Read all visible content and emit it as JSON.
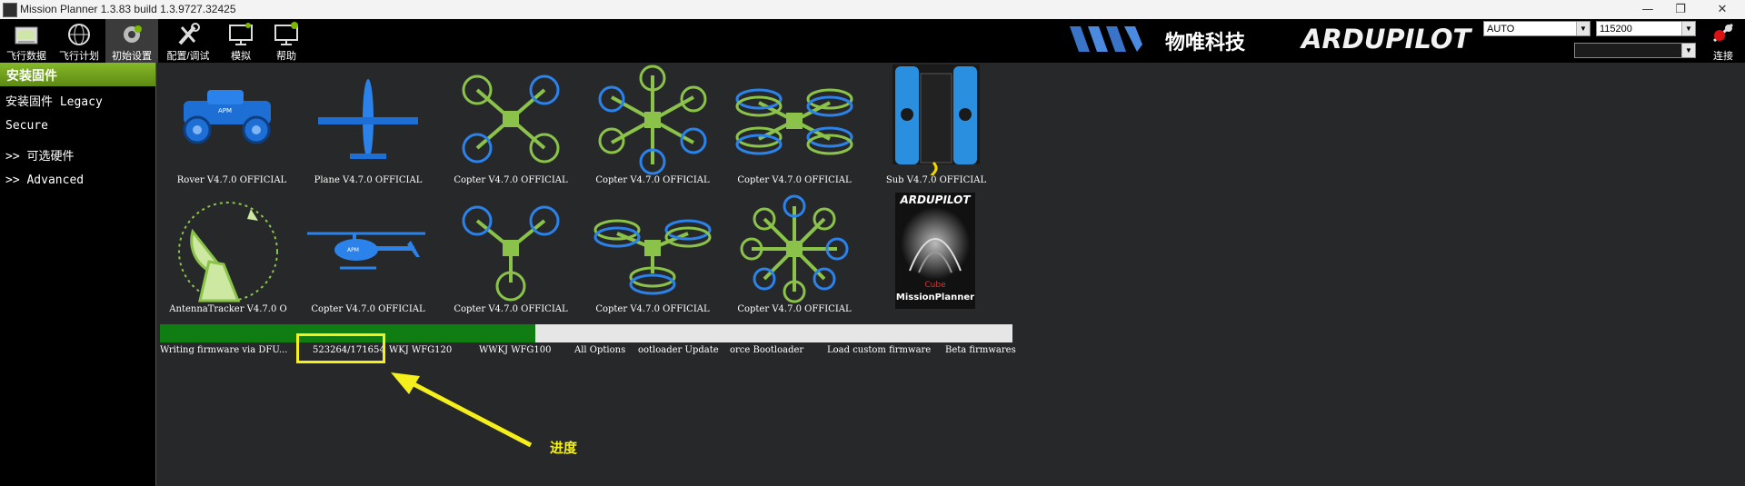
{
  "window": {
    "title": "Mission Planner 1.3.83 build 1.3.9727.32425"
  },
  "toolbar": {
    "items": [
      {
        "label": "飞行数据",
        "icon": "flight-data-icon"
      },
      {
        "label": "飞行计划",
        "icon": "flight-plan-icon"
      },
      {
        "label": "初始设置",
        "icon": "initial-setup-icon"
      },
      {
        "label": "配置/调试",
        "icon": "config-tuning-icon"
      },
      {
        "label": "模拟",
        "icon": "simulation-icon"
      },
      {
        "label": "帮助",
        "icon": "help-icon"
      }
    ],
    "brand_logo_text": "物唯科技",
    "ardupilot_logo": "ARDUPILOT",
    "port_select": "AUTO",
    "baud_select": "115200",
    "connect_label": "连接"
  },
  "sidebar": {
    "active": "安装固件",
    "items": [
      "安装固件 Legacy",
      "Secure",
      ">> 可选硬件",
      ">> Advanced"
    ]
  },
  "firmware": {
    "row1": [
      {
        "caption": "Rover V4.7.0 OFFICIAL",
        "icon": "rover-icon"
      },
      {
        "caption": "Plane V4.7.0 OFFICIAL",
        "icon": "plane-icon"
      },
      {
        "caption": "Copter V4.7.0 OFFICIAL",
        "icon": "quad-x-icon"
      },
      {
        "caption": "Copter V4.7.0 OFFICIAL",
        "icon": "hexa-icon"
      },
      {
        "caption": "Copter V4.7.0 OFFICIAL",
        "icon": "coax-quad-icon"
      },
      {
        "caption": "Sub V4.7.0 OFFICIAL",
        "icon": "sub-icon"
      }
    ],
    "row2": [
      {
        "caption": "AntennaTracker  V4.7.0 O",
        "icon": "antenna-tracker-icon"
      },
      {
        "caption": "Copter V4.7.0 OFFICIAL",
        "icon": "helicopter-icon"
      },
      {
        "caption": "Copter V4.7.0 OFFICIAL",
        "icon": "tri-icon"
      },
      {
        "caption": "Copter V4.7.0 OFFICIAL",
        "icon": "y6-icon"
      },
      {
        "caption": "Copter V4.7.0 OFFICIAL",
        "icon": "octa-icon"
      },
      {
        "caption": "Cube MissionPlanner",
        "icon": "cube-missionplanner-icon"
      }
    ],
    "cube_logo": "ARDUPILOT",
    "cube_label": "Cube",
    "cube_mp": "MissionPlanner"
  },
  "progress": {
    "fraction": 0.44,
    "color": "#0f7d12"
  },
  "status": {
    "writing": "Writing firmware via DFU...",
    "count": "523264/171654",
    "links": [
      "WKJ WFG120",
      "WWKJ WFG100",
      "All Options",
      "ootloader Update",
      "orce Bootloader",
      "Load custom firmware",
      "Beta firmwares"
    ]
  },
  "annotation": {
    "label": "进度",
    "color": "#f5ef1c"
  }
}
